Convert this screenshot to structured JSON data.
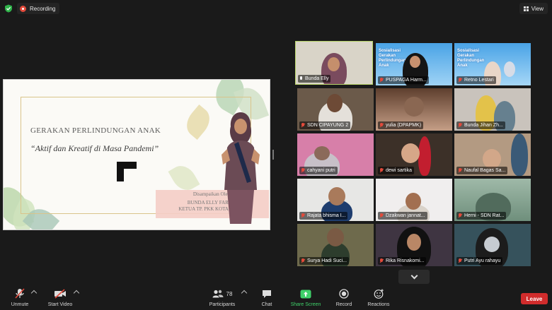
{
  "topbar": {
    "recording_label": "Recording",
    "view_label": "View"
  },
  "slide": {
    "title_line1": "GERAKAN PERLINDUNGAN ANAK",
    "title_line2": "“Aktif dan Kreatif di Masa Pandemi”",
    "credit_line1": "Disampaikan Oleh:",
    "credit_line2": "BUNDA ELLY FARIDA",
    "credit_line3": "KETUA TP. PKK KOTA DEPOK"
  },
  "gallery": {
    "banner_text": "Sosialisasi Gerakan Perlindungan Anak",
    "participants": [
      {
        "name": "Bunda Elly",
        "muted": false,
        "active": true
      },
      {
        "name": "PUSPAGA Harm...",
        "muted": true
      },
      {
        "name": "Retno Lestari",
        "muted": true
      },
      {
        "name": "SDN CIPAYUNG 2",
        "muted": true
      },
      {
        "name": "yulia (DPAPMK)",
        "muted": true
      },
      {
        "name": "Bunda Jihan Zh...",
        "muted": true
      },
      {
        "name": "cahyani putri",
        "muted": true
      },
      {
        "name": "dewi sartika",
        "muted": true
      },
      {
        "name": "Naufal Bagas Sa...",
        "muted": true
      },
      {
        "name": "Rajata bhisma I...",
        "muted": true
      },
      {
        "name": "Dzakwan jannat...",
        "muted": true
      },
      {
        "name": "Herni - SDN Rat...",
        "muted": true
      },
      {
        "name": "Surya Hadi Suci...",
        "muted": true
      },
      {
        "name": "Rika Risnakomi...",
        "muted": true
      },
      {
        "name": "Putri Ayu rahayu",
        "muted": true
      }
    ]
  },
  "toolbar": {
    "unmute": "Unmute",
    "start_video": "Start Video",
    "participants_label": "Participants",
    "participants_count": "78",
    "chat": "Chat",
    "share_screen": "Share Screen",
    "record": "Record",
    "reactions": "Reactions",
    "leave": "Leave"
  },
  "colors": {
    "background": "#1a1a1a",
    "leave_red": "#d12c2c",
    "share_green": "#3fd16a",
    "active_speaker": "#b8d46a",
    "recording_red": "#e24a3b"
  }
}
